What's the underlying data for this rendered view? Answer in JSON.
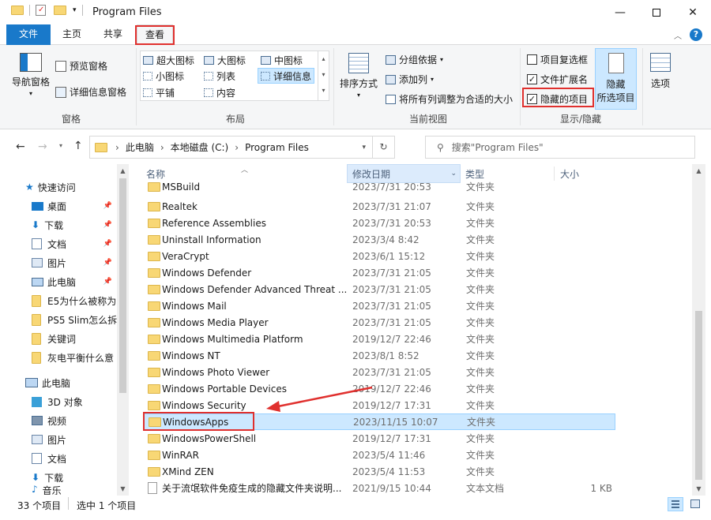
{
  "window": {
    "title": "Program Files"
  },
  "tabs": {
    "file": "文件",
    "home": "主页",
    "share": "共享",
    "view": "查看"
  },
  "ribbon": {
    "panes": {
      "nav_pane": "导航窗格",
      "preview_pane": "预览窗格",
      "details_pane": "详细信息窗格",
      "group_label": "窗格"
    },
    "layout": {
      "items": [
        "超大图标",
        "大图标",
        "中图标",
        "小图标",
        "列表",
        "详细信息",
        "平铺",
        "内容"
      ],
      "group_label": "布局"
    },
    "current_view": {
      "sort_by": "排序方式",
      "group_by": "分组依据",
      "add_column": "添加列",
      "fit_columns": "将所有列调整为合适的大小",
      "group_label": "当前视图"
    },
    "show_hide": {
      "item_checkboxes": {
        "label": "项目复选框",
        "checked": false
      },
      "file_extensions": {
        "label": "文件扩展名",
        "checked": true
      },
      "hidden_items": {
        "label": "隐藏的项目",
        "checked": true
      },
      "hide_selected_line1": "隐藏",
      "hide_selected_line2": "所选项目",
      "group_label": "显示/隐藏"
    },
    "options": "选项"
  },
  "address": {
    "crumbs": [
      "此电脑",
      "本地磁盘 (C:)",
      "Program Files"
    ],
    "search_placeholder": "搜索\"Program Files\""
  },
  "nav": {
    "quick_access": "快速访问",
    "items": [
      "桌面",
      "下载",
      "文档",
      "图片",
      "此电脑",
      "E5为什么被称为",
      "PS5 Slim怎么拆",
      "关键词",
      "灰电平衡什么意"
    ],
    "this_pc": "此电脑",
    "pc_items": [
      "3D 对象",
      "视频",
      "图片",
      "文档",
      "下载",
      "音乐"
    ]
  },
  "columns": {
    "name": "名称",
    "date": "修改日期",
    "type": "类型",
    "size": "大小"
  },
  "files": [
    {
      "name": "MSBuild",
      "date": "2023/7/31 20:53",
      "type": "文件夹",
      "size": "",
      "icon": "folder-icon"
    },
    {
      "name": "Realtek",
      "date": "2023/7/31 21:07",
      "type": "文件夹",
      "size": "",
      "icon": "folder-icon"
    },
    {
      "name": "Reference Assemblies",
      "date": "2023/7/31 20:53",
      "type": "文件夹",
      "size": "",
      "icon": "folder-icon"
    },
    {
      "name": "Uninstall Information",
      "date": "2023/3/4 8:42",
      "type": "文件夹",
      "size": "",
      "icon": "folder-icon"
    },
    {
      "name": "VeraCrypt",
      "date": "2023/6/1 15:12",
      "type": "文件夹",
      "size": "",
      "icon": "folder-icon"
    },
    {
      "name": "Windows Defender",
      "date": "2023/7/31 21:05",
      "type": "文件夹",
      "size": "",
      "icon": "folder-icon"
    },
    {
      "name": "Windows Defender Advanced Threat ...",
      "date": "2023/7/31 21:05",
      "type": "文件夹",
      "size": "",
      "icon": "folder-icon"
    },
    {
      "name": "Windows Mail",
      "date": "2023/7/31 21:05",
      "type": "文件夹",
      "size": "",
      "icon": "folder-icon"
    },
    {
      "name": "Windows Media Player",
      "date": "2023/7/31 21:05",
      "type": "文件夹",
      "size": "",
      "icon": "folder-icon"
    },
    {
      "name": "Windows Multimedia Platform",
      "date": "2019/12/7 22:46",
      "type": "文件夹",
      "size": "",
      "icon": "folder-icon"
    },
    {
      "name": "Windows NT",
      "date": "2023/8/1 8:52",
      "type": "文件夹",
      "size": "",
      "icon": "folder-icon"
    },
    {
      "name": "Windows Photo Viewer",
      "date": "2023/7/31 21:05",
      "type": "文件夹",
      "size": "",
      "icon": "folder-icon"
    },
    {
      "name": "Windows Portable Devices",
      "date": "2019/12/7 22:46",
      "type": "文件夹",
      "size": "",
      "icon": "folder-icon"
    },
    {
      "name": "Windows Security",
      "date": "2019/12/7 17:31",
      "type": "文件夹",
      "size": "",
      "icon": "folder-icon"
    },
    {
      "name": "WindowsApps",
      "date": "2023/11/15 10:07",
      "type": "文件夹",
      "size": "",
      "icon": "folder-icon",
      "selected": true
    },
    {
      "name": "WindowsPowerShell",
      "date": "2019/12/7 17:31",
      "type": "文件夹",
      "size": "",
      "icon": "folder-icon"
    },
    {
      "name": "WinRAR",
      "date": "2023/5/4 11:46",
      "type": "文件夹",
      "size": "",
      "icon": "folder-icon"
    },
    {
      "name": "XMind ZEN",
      "date": "2023/5/4 11:53",
      "type": "文件夹",
      "size": "",
      "icon": "folder-icon"
    },
    {
      "name": "关于流氓软件免疫生成的隐藏文件夹说明...",
      "date": "2021/9/15 10:44",
      "type": "文本文档",
      "size": "1 KB",
      "icon": "text-file-icon"
    }
  ],
  "status": {
    "count": "33 个项目",
    "selected": "选中 1 个项目"
  },
  "colors": {
    "accent": "#1979ca",
    "highlight": "#e0302e",
    "selection": "#cce8ff"
  }
}
